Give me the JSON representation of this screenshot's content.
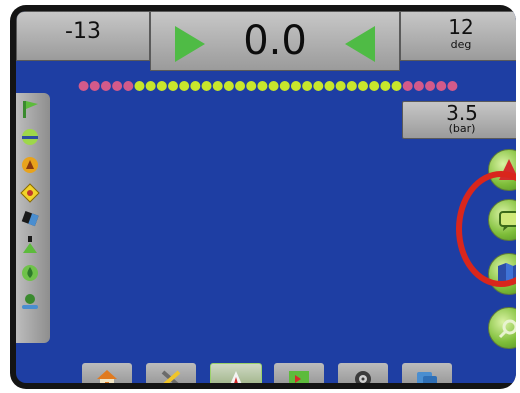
{
  "status_bar": {
    "cross_track": "-13",
    "speed": "0.0",
    "heading_value": "12",
    "heading_unit": "deg"
  },
  "pressure": {
    "value": "3.5",
    "unit": "(bar)"
  },
  "boom_sections": {
    "left_inactive": 5,
    "active": 24,
    "right_inactive": 5,
    "inactive_color": "#d35a8a",
    "active_color": "#c8e62c"
  },
  "left_toolbar": {
    "icons": [
      "flag-icon",
      "guidance-line-icon",
      "mode-icon",
      "warning-icon",
      "tilt-icon",
      "boom-height-icon",
      "droplet-icon",
      "level-icon"
    ]
  },
  "right_buttons": {
    "icons": [
      "vehicle-view-icon",
      "chat-window-icon",
      "map-layers-icon",
      "zoom-icon"
    ]
  },
  "bottom_tabs": {
    "icons": [
      "home-icon",
      "tools-icon",
      "guidance-icon",
      "map-icon",
      "gauge-icon",
      "camera-icon"
    ],
    "active_index": 2
  },
  "colors": {
    "screen": "#1e3ea3",
    "accent_green": "#5dbb3c",
    "highlight_red": "#d9261c"
  }
}
